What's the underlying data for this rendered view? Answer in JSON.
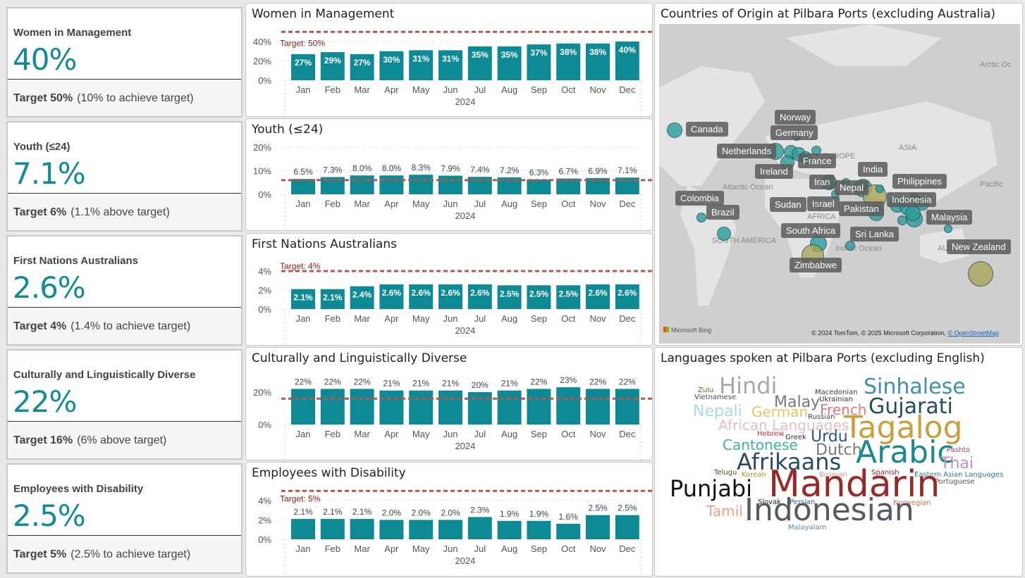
{
  "kpis": [
    {
      "title": "Women in Management",
      "value": "40%",
      "target": "Target 50%",
      "note": "(10% to achieve target)"
    },
    {
      "title": "Youth (≤24)",
      "value": "7.1%",
      "target": "Target 6%",
      "note": "(1.1% above target)"
    },
    {
      "title": "First Nations Australians",
      "value": "2.6%",
      "target": "Target 4%",
      "note": "(1.4% to achieve target)"
    },
    {
      "title": "Culturally and Linguistically Diverse",
      "value": "22%",
      "target": "Target 16%",
      "note": "(6% above target)"
    },
    {
      "title": "Employees with Disability",
      "value": "2.5%",
      "target": "Target 5%",
      "note": "(2.5% to achieve target)"
    }
  ],
  "chart_data": [
    {
      "type": "bar",
      "title": "Women in Management",
      "categories": [
        "Jan",
        "Feb",
        "Mar",
        "Apr",
        "May",
        "Jun",
        "Jul",
        "Aug",
        "Sep",
        "Oct",
        "Nov",
        "Dec"
      ],
      "xlabel": "2024",
      "values": [
        27,
        29,
        27,
        30,
        31,
        31,
        35,
        35,
        37,
        38,
        38,
        40
      ],
      "labels": [
        "27%",
        "29%",
        "27%",
        "30%",
        "31%",
        "31%",
        "35%",
        "35%",
        "37%",
        "38%",
        "38%",
        "40%"
      ],
      "yticks": [
        "0%",
        "20%",
        "40%"
      ],
      "ytick_values": [
        0,
        20,
        40
      ],
      "target": 50,
      "target_label": "Target: 50%",
      "label_position": "inside",
      "bar_color": "#0e8a94",
      "target_color": "#b85450"
    },
    {
      "type": "bar",
      "title": "Youth (≤24)",
      "categories": [
        "Jan",
        "Feb",
        "Mar",
        "Apr",
        "May",
        "Jun",
        "Jul",
        "Aug",
        "Sep",
        "Oct",
        "Nov",
        "Dec"
      ],
      "xlabel": "2024",
      "values": [
        6.5,
        7.3,
        8.0,
        8.0,
        8.3,
        7.9,
        7.4,
        7.2,
        6.3,
        6.7,
        6.9,
        7.1
      ],
      "labels": [
        "6.5%",
        "7.3%",
        "8.0%",
        "8.0%",
        "8.3%",
        "7.9%",
        "7.4%",
        "7.2%",
        "6.3%",
        "6.7%",
        "6.9%",
        "7.1%"
      ],
      "yticks": [
        "0%",
        "10%",
        "20%"
      ],
      "ytick_values": [
        0,
        10,
        20
      ],
      "target": 6,
      "target_label": "",
      "label_position": "above",
      "bar_color": "#0e8a94",
      "target_color": "#b85450"
    },
    {
      "type": "bar",
      "title": "First Nations Australians",
      "categories": [
        "Jan",
        "Feb",
        "Mar",
        "Apr",
        "May",
        "Jun",
        "Jul",
        "Aug",
        "Sep",
        "Oct",
        "Nov",
        "Dec"
      ],
      "xlabel": "2024",
      "values": [
        2.1,
        2.1,
        2.4,
        2.6,
        2.6,
        2.6,
        2.6,
        2.5,
        2.5,
        2.5,
        2.6,
        2.6
      ],
      "labels": [
        "2.1%",
        "2.1%",
        "2.4%",
        "2.6%",
        "2.6%",
        "2.6%",
        "2.6%",
        "2.5%",
        "2.5%",
        "2.5%",
        "2.6%",
        "2.6%"
      ],
      "yticks": [
        "0%",
        "2%",
        "4%"
      ],
      "ytick_values": [
        0,
        2,
        4
      ],
      "target": 4,
      "target_label": "Target: 4%",
      "label_position": "inside",
      "bar_color": "#0e8a94",
      "target_color": "#b85450"
    },
    {
      "type": "bar",
      "title": "Culturally and Linguistically Diverse",
      "categories": [
        "Jan",
        "Feb",
        "Mar",
        "Apr",
        "May",
        "Jun",
        "Jul",
        "Aug",
        "Sep",
        "Oct",
        "Nov",
        "Dec"
      ],
      "xlabel": "2024",
      "values": [
        22,
        22,
        22,
        21,
        21,
        21,
        20,
        21,
        22,
        23,
        22,
        22
      ],
      "labels": [
        "22%",
        "22%",
        "22%",
        "21%",
        "21%",
        "21%",
        "20%",
        "21%",
        "22%",
        "23%",
        "22%",
        "22%"
      ],
      "yticks": [
        "0%",
        "20%"
      ],
      "ytick_values": [
        0,
        20
      ],
      "target": 16,
      "target_label": "",
      "label_position": "above",
      "bar_color": "#0e8a94",
      "target_color": "#b85450"
    },
    {
      "type": "bar",
      "title": "Employees with Disability",
      "categories": [
        "Jan",
        "Feb",
        "Mar",
        "Apr",
        "May",
        "Jun",
        "Jul",
        "Aug",
        "Sep",
        "Oct",
        "Nov",
        "Dec"
      ],
      "xlabel": "2024",
      "values": [
        2.1,
        2.1,
        2.1,
        2.0,
        2.0,
        2.0,
        2.3,
        1.9,
        1.9,
        1.6,
        2.5,
        2.5
      ],
      "labels": [
        "2.1%",
        "2.1%",
        "2.1%",
        "2.0%",
        "2.0%",
        "2.0%",
        "2.3%",
        "1.9%",
        "1.9%",
        "1.6%",
        "2.5%",
        "2.5%"
      ],
      "yticks": [
        "0%",
        "2%",
        "4%"
      ],
      "ytick_values": [
        0,
        2,
        4
      ],
      "target": 5,
      "target_label": "Target: 5%",
      "label_position": "above",
      "bar_color": "#0e8a94",
      "target_color": "#b85450"
    }
  ],
  "map": {
    "title": "Countries of Origin at Pilbara Ports (excluding Australia)",
    "geo_labels": [
      "Arctic Oc",
      "ASIA",
      "EUROPE",
      "Atlantic Ocean",
      "Pacific",
      "AFRICA",
      "SOUTH AMERICA",
      "Indian Ocean",
      "AUSTRALIA"
    ],
    "countries": [
      "Norway",
      "Canada",
      "Germany",
      "Netherlands",
      "France",
      "Ireland",
      "India",
      "Iran",
      "Nepal",
      "Philippines",
      "Colombia",
      "Brazil",
      "Sudan",
      "Israel",
      "Pakistan",
      "Indonesia",
      "Malaysia",
      "South Africa",
      "Sri Lanka",
      "New Zealand",
      "Zimbabwe"
    ],
    "bubble_color": "#2a9d9d",
    "bubble_highlight_color": "#a9a65a",
    "logo": "Microsoft Bing",
    "attribution": "© 2024 TomTom, © 2025 Microsoft Corporation,",
    "attribution_link": "© OpenStreetMap"
  },
  "wordcloud": {
    "title": "Languages spoken at Pilbara Ports (excluding English)",
    "words": [
      {
        "text": "Zulu",
        "color": "#8a5a2a"
      },
      {
        "text": "Vietnamese",
        "color": "#4a4a4a"
      },
      {
        "text": "Hindi",
        "color": "#a8a8a8"
      },
      {
        "text": "Macedonian",
        "color": "#3a3a4a"
      },
      {
        "text": "Ukrainian",
        "color": "#333333"
      },
      {
        "text": "Sinhalese",
        "color": "#3f90b0"
      },
      {
        "text": "Malay",
        "color": "#777777"
      },
      {
        "text": "Nepali",
        "color": "#a8dae8"
      },
      {
        "text": "German",
        "color": "#e8c462"
      },
      {
        "text": "French",
        "color": "#e87878"
      },
      {
        "text": "Gujarati",
        "color": "#1f4f5a"
      },
      {
        "text": "Russian",
        "color": "#3a4a4a"
      },
      {
        "text": "African Languages",
        "color": "#e3c0c2"
      },
      {
        "text": "Tagalog",
        "color": "#c8a040"
      },
      {
        "text": "Hebrew",
        "color": "#c03030"
      },
      {
        "text": "Greek",
        "color": "#333333"
      },
      {
        "text": "Urdu",
        "color": "#2a5a7a"
      },
      {
        "text": "Cantonese",
        "color": "#40b0a8"
      },
      {
        "text": "Dutch",
        "color": "#777777"
      },
      {
        "text": "Arabic",
        "color": "#1a8a90"
      },
      {
        "text": "Pashto",
        "color": "#8a4a6a"
      },
      {
        "text": "Thai",
        "color": "#c090c0"
      },
      {
        "text": "Afrikaans",
        "color": "#2a4a6a"
      },
      {
        "text": "Telugu",
        "color": "#5a4a1a"
      },
      {
        "text": "Korean",
        "color": "#b09020"
      },
      {
        "text": "Bosnian",
        "color": "#c0a0a0"
      },
      {
        "text": "Spanish",
        "color": "#8a2a2a"
      },
      {
        "text": "Eastern Asian Languages",
        "color": "#208080"
      },
      {
        "text": "Portuguese",
        "color": "#555555"
      },
      {
        "text": "Punjabi",
        "color": "#111111"
      },
      {
        "text": "Mandarin",
        "color": "#9a2a2a"
      },
      {
        "text": "Slovak",
        "color": "#222222"
      },
      {
        "text": "Persian",
        "color": "#3a5a7a"
      },
      {
        "text": "Norwegian",
        "color": "#d07050"
      },
      {
        "text": "Tamil",
        "color": "#f0a088"
      },
      {
        "text": "Indonesian",
        "color": "#555a60"
      },
      {
        "text": "Malayalam",
        "color": "#5a8ab0"
      }
    ]
  }
}
